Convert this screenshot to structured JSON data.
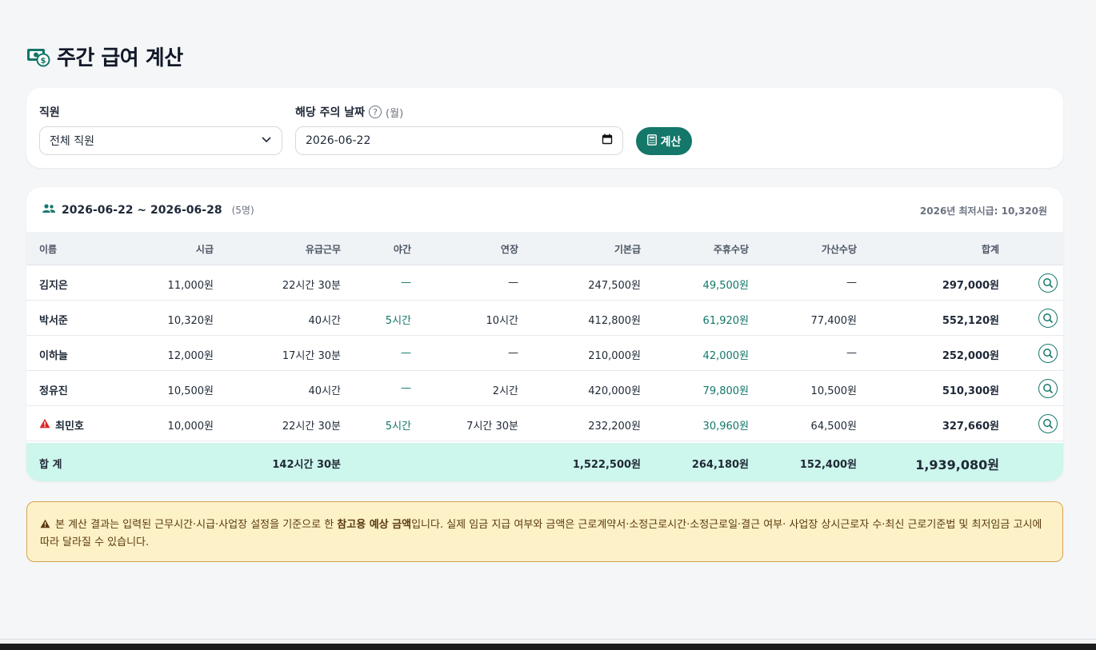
{
  "page": {
    "title": "주간 급여 계산"
  },
  "filters": {
    "employee_label": "직원",
    "employee_value": "전체 직원",
    "date_label": "해당 주의 날짜",
    "date_help": "?",
    "date_note": "(월)",
    "date_value": "2026-06-22",
    "calc_label": "계산"
  },
  "result": {
    "period": "2026-06-22 ~ 2026-06-28",
    "headcount": "(5명)",
    "min_wage": "2026년 최저시급: 10,320원",
    "columns": [
      "이름",
      "시급",
      "유급근무",
      "야간",
      "연장",
      "기본급",
      "주휴수당",
      "가산수당",
      "합계"
    ],
    "rows": [
      {
        "name": "김지은",
        "warn": false,
        "wage": "11,000원",
        "paid": "22시간 30분",
        "night": "—",
        "overtime": "—",
        "base": "247,500원",
        "weekly": "49,500원",
        "extra": "—",
        "total": "297,000원"
      },
      {
        "name": "박서준",
        "warn": false,
        "wage": "10,320원",
        "paid": "40시간",
        "night": "5시간",
        "overtime": "10시간",
        "base": "412,800원",
        "weekly": "61,920원",
        "extra": "77,400원",
        "total": "552,120원"
      },
      {
        "name": "이하늘",
        "warn": false,
        "wage": "12,000원",
        "paid": "17시간 30분",
        "night": "—",
        "overtime": "—",
        "base": "210,000원",
        "weekly": "42,000원",
        "extra": "—",
        "total": "252,000원"
      },
      {
        "name": "정유진",
        "warn": false,
        "wage": "10,500원",
        "paid": "40시간",
        "night": "—",
        "overtime": "2시간",
        "base": "420,000원",
        "weekly": "79,800원",
        "extra": "10,500원",
        "total": "510,300원"
      },
      {
        "name": "최민호",
        "warn": true,
        "wage": "10,000원",
        "paid": "22시간 30분",
        "night": "5시간",
        "overtime": "7시간 30분",
        "base": "232,200원",
        "weekly": "30,960원",
        "extra": "64,500원",
        "total": "327,660원"
      }
    ],
    "totals": {
      "label": "합 계",
      "paid": "142시간 30분",
      "base": "1,522,500원",
      "weekly": "264,180원",
      "extra": "152,400원",
      "total": "1,939,080원"
    }
  },
  "notice": {
    "prefix": "본 계산 결과는 입력된 근무시간·시급·사업장 설정을 기준으로 한 ",
    "emphasis": "참고용 예상 금액",
    "suffix": "입니다. 실제 임금 지급 여부와 금액은 근로계약서·소정근로시간·소정근로일·결근 여부· 사업장 상시근로자 수·최신 근로기준법 및 최저임금 고시에 따라 달라질 수 있습니다."
  },
  "colors": {
    "accent": "#14776a",
    "total_bg": "#cdf6ec",
    "notice_bg": "#fdf1c7",
    "warning": "#dc2626"
  }
}
